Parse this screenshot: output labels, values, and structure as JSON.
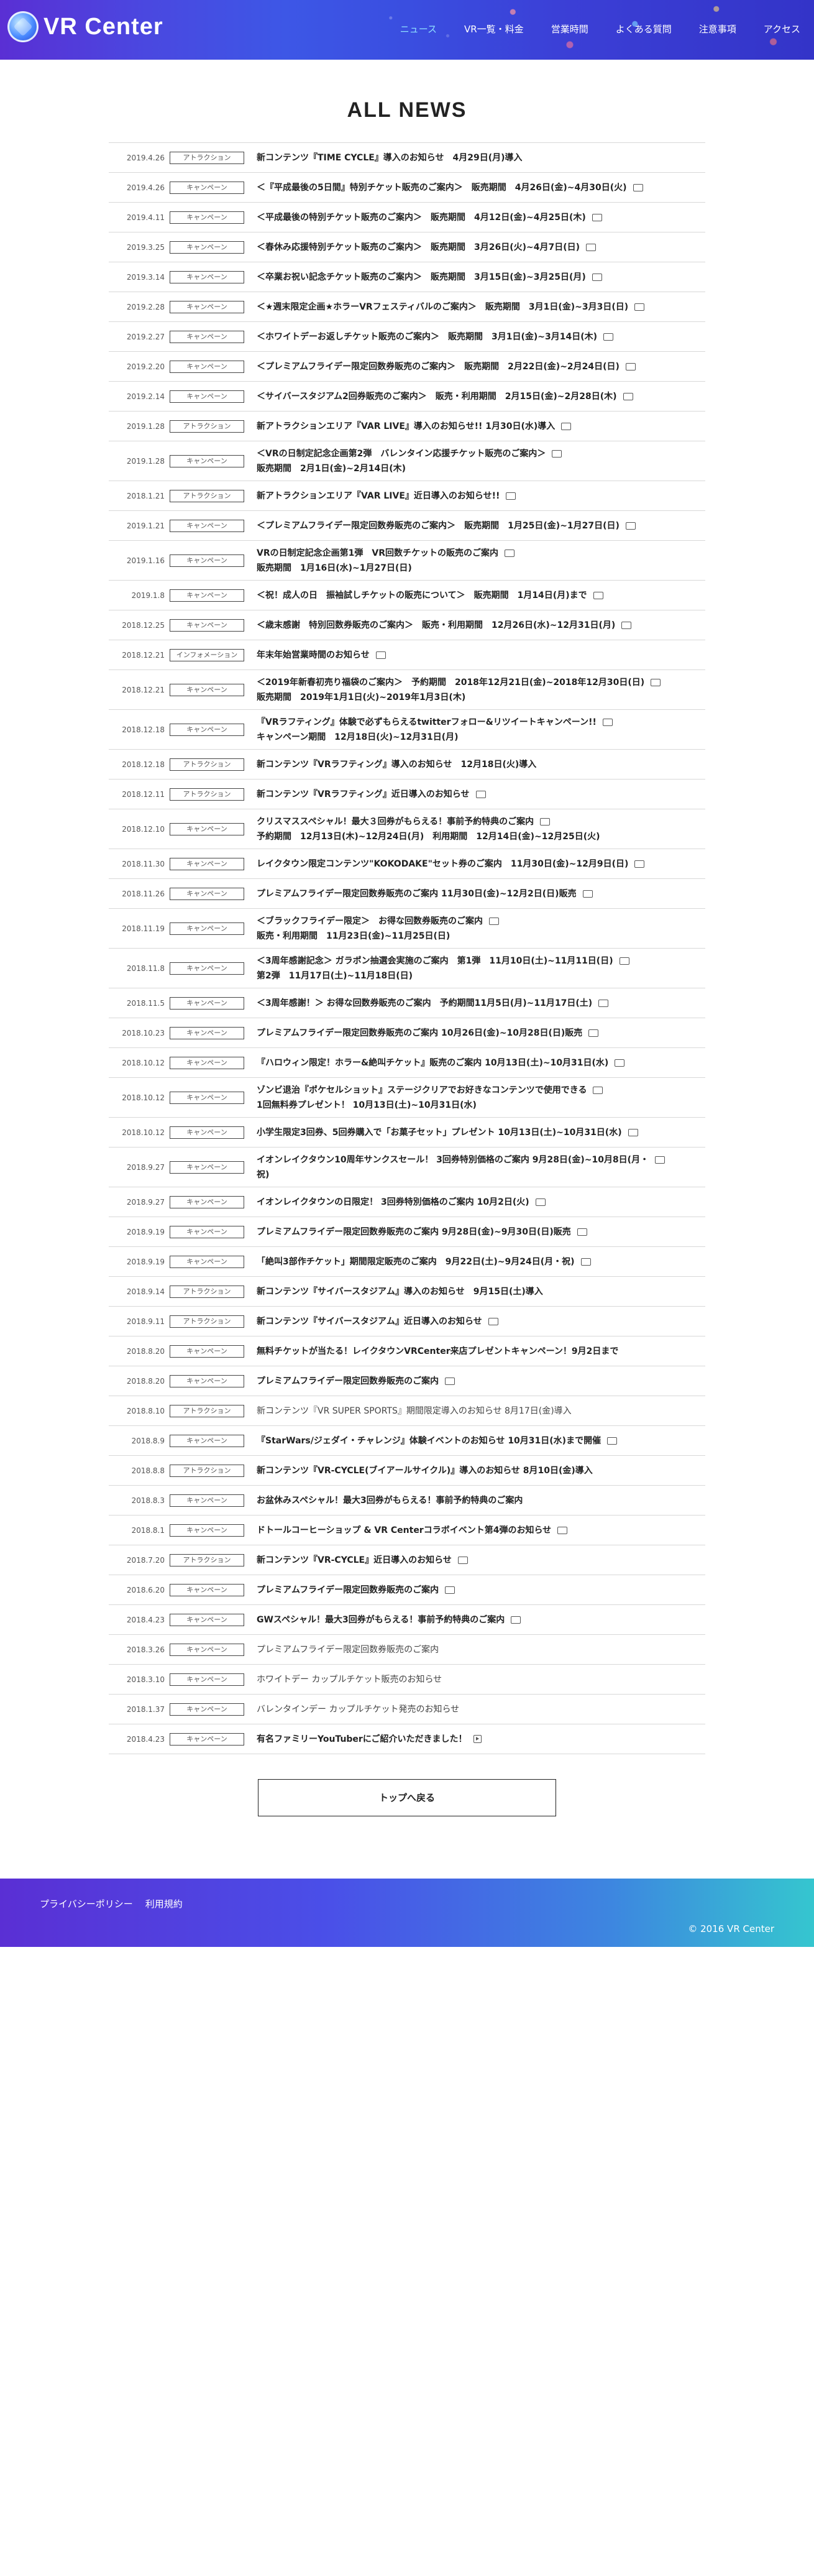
{
  "header": {
    "logo_text": "VR Center",
    "nav": [
      {
        "label": "ニュース",
        "active": true
      },
      {
        "label": "VR一覧・料金",
        "active": false
      },
      {
        "label": "営業時間",
        "active": false
      },
      {
        "label": "よくある質問",
        "active": false
      },
      {
        "label": "注意事項",
        "active": false
      },
      {
        "label": "アクセス",
        "active": false
      }
    ]
  },
  "page_title": "ALL NEWS",
  "news": [
    {
      "date": "2019.4.26",
      "category": "アトラクション",
      "lines": [
        "新コンテンツ『TIME CYCLE』導入のお知らせ　4月29日(月)導入"
      ],
      "icon": ""
    },
    {
      "date": "2019.4.26",
      "category": "キャンペーン",
      "lines": [
        "＜『平成最後の5日間』特別チケット販売のご案内＞　販売期間　4月26日(金)~4月30日(火)"
      ],
      "icon": "chat"
    },
    {
      "date": "2019.4.11",
      "category": "キャンペーン",
      "lines": [
        "＜平成最後の特別チケット販売のご案内＞　販売期間　4月12日(金)~4月25日(木)"
      ],
      "icon": "chat"
    },
    {
      "date": "2019.3.25",
      "category": "キャンペーン",
      "lines": [
        "＜春休み応援特別チケット販売のご案内＞　販売期間　3月26日(火)~4月7日(日)"
      ],
      "icon": "chat"
    },
    {
      "date": "2019.3.14",
      "category": "キャンペーン",
      "lines": [
        "＜卒業お祝い記念チケット販売のご案内＞　販売期間　3月15日(金)~3月25日(月)"
      ],
      "icon": "chat"
    },
    {
      "date": "2019.2.28",
      "category": "キャンペーン",
      "lines": [
        "＜★週末限定企画★ホラーVRフェスティバルのご案内＞　販売期間　3月1日(金)~3月3日(日)"
      ],
      "icon": "chat"
    },
    {
      "date": "2019.2.27",
      "category": "キャンペーン",
      "lines": [
        "＜ホワイトデーお返しチケット販売のご案内＞　販売期間　3月1日(金)~3月14日(木)"
      ],
      "icon": "chat"
    },
    {
      "date": "2019.2.20",
      "category": "キャンペーン",
      "lines": [
        "＜プレミアムフライデー限定回数券販売のご案内＞　販売期間　2月22日(金)~2月24日(日)"
      ],
      "icon": "chat"
    },
    {
      "date": "2019.2.14",
      "category": "キャンペーン",
      "lines": [
        "＜サイバースタジアム2回券販売のご案内＞　販売・利用期間　2月15日(金)~2月28日(木)"
      ],
      "icon": "chat"
    },
    {
      "date": "2019.1.28",
      "category": "アトラクション",
      "lines": [
        "新アトラクションエリア『VAR LIVE』導入のお知らせ!! 1月30日(水)導入"
      ],
      "icon": "chat"
    },
    {
      "date": "2019.1.28",
      "category": "キャンペーン",
      "lines": [
        "＜VRの日制定記念企画第2弾　バレンタイン応援チケット販売のご案内＞",
        "販売期間　2月1日(金)~2月14日(木)"
      ],
      "icon": "chat"
    },
    {
      "date": "2018.1.21",
      "category": "アトラクション",
      "lines": [
        "新アトラクションエリア『VAR LIVE』近日導入のお知らせ!!"
      ],
      "icon": "chat"
    },
    {
      "date": "2019.1.21",
      "category": "キャンペーン",
      "lines": [
        "＜プレミアムフライデー限定回数券販売のご案内＞　販売期間　1月25日(金)~1月27日(日)"
      ],
      "icon": "chat"
    },
    {
      "date": "2019.1.16",
      "category": "キャンペーン",
      "lines": [
        "VRの日制定記念企画第1弾　VR回数チケットの販売のご案内",
        "販売期間　1月16日(水)~1月27日(日)"
      ],
      "icon": "chat"
    },
    {
      "date": "2019.1.8",
      "category": "キャンペーン",
      "lines": [
        "＜祝！成人の日　振袖試しチケットの販売について＞　販売期間　1月14日(月)まで"
      ],
      "icon": "chat"
    },
    {
      "date": "2018.12.25",
      "category": "キャンペーン",
      "lines": [
        "＜歳末感謝　特別回数券販売のご案内＞　販売・利用期間　12月26日(水)~12月31日(月)"
      ],
      "icon": "chat"
    },
    {
      "date": "2018.12.21",
      "category": "インフォメーション",
      "lines": [
        "年末年始営業時間のお知らせ"
      ],
      "icon": "chat"
    },
    {
      "date": "2018.12.21",
      "category": "キャンペーン",
      "lines": [
        "＜2019年新春初売り福袋のご案内＞　予約期間　2018年12月21日(金)~2018年12月30日(日)",
        "販売期間　2019年1月1日(火)~2019年1月3日(木)"
      ],
      "icon": "chat"
    },
    {
      "date": "2018.12.18",
      "category": "キャンペーン",
      "lines": [
        "『VRラフティング』体験で必ずもらえるtwitterフォロー&リツイートキャンペーン!!",
        "キャンペーン期間　12月18日(火)~12月31日(月)"
      ],
      "icon": "chat"
    },
    {
      "date": "2018.12.18",
      "category": "アトラクション",
      "lines": [
        "新コンテンツ『VRラフティング』導入のお知らせ　12月18日(火)導入"
      ],
      "icon": ""
    },
    {
      "date": "2018.12.11",
      "category": "アトラクション",
      "lines": [
        "新コンテンツ『VRラフティング』近日導入のお知らせ"
      ],
      "icon": "chat"
    },
    {
      "date": "2018.12.10",
      "category": "キャンペーン",
      "lines": [
        "クリスマススペシャル！最大３回券がもらえる！事前予約特典のご案内",
        "予約期間　12月13日(木)~12月24日(月)　利用期間　12月14日(金)~12月25日(火)"
      ],
      "icon": "chat"
    },
    {
      "date": "2018.11.30",
      "category": "キャンペーン",
      "lines": [
        "レイクタウン限定コンテンツ\"KOKODAKE\"セット券のご案内　11月30日(金)~12月9日(日)"
      ],
      "icon": "chat"
    },
    {
      "date": "2018.11.26",
      "category": "キャンペーン",
      "lines": [
        "プレミアムフライデー限定回数券販売のご案内 11月30日(金)~12月2日(日)販売"
      ],
      "icon": "chat"
    },
    {
      "date": "2018.11.19",
      "category": "キャンペーン",
      "lines": [
        "＜ブラックフライデー限定＞　お得な回数券販売のご案内",
        "販売・利用期間　11月23日(金)~11月25日(日)"
      ],
      "icon": "chat"
    },
    {
      "date": "2018.11.8",
      "category": "キャンペーン",
      "lines": [
        "＜3周年感謝記念＞ ガラポン抽選会実施のご案内　第1弾　11月10日(土)~11月11日(日)",
        "第2弾　11月17日(土)~11月18日(日)"
      ],
      "icon": "chat"
    },
    {
      "date": "2018.11.5",
      "category": "キャンペーン",
      "lines": [
        "＜3周年感謝！＞ お得な回数券販売のご案内　予約期間11月5日(月)~11月17日(土)"
      ],
      "icon": "chat"
    },
    {
      "date": "2018.10.23",
      "category": "キャンペーン",
      "lines": [
        "プレミアムフライデー限定回数券販売のご案内 10月26日(金)~10月28日(日)販売"
      ],
      "icon": "chat"
    },
    {
      "date": "2018.10.12",
      "category": "キャンペーン",
      "lines": [
        "『ハロウィン限定！ホラー&絶叫チケット』販売のご案内 10月13日(土)~10月31日(水)"
      ],
      "icon": "chat"
    },
    {
      "date": "2018.10.12",
      "category": "キャンペーン",
      "lines": [
        "ゾンビ退治『ポケセルショット』ステージクリアでお好きなコンテンツで使用できる",
        "1回無料券プレゼント！ 10月13日(土)~10月31日(水)"
      ],
      "icon": "chat"
    },
    {
      "date": "2018.10.12",
      "category": "キャンペーン",
      "lines": [
        "小学生限定3回券、5回券購入で「お菓子セット」プレゼント 10月13日(土)~10月31日(水)"
      ],
      "icon": "chat"
    },
    {
      "date": "2018.9.27",
      "category": "キャンペーン",
      "lines": [
        "イオンレイクタウン10周年サンクスセール！ 3回券特別価格のご案内 9月28日(金)~10月8日(月・",
        "祝)"
      ],
      "icon": "chat"
    },
    {
      "date": "2018.9.27",
      "category": "キャンペーン",
      "lines": [
        "イオンレイクタウンの日限定！ 3回券特別価格のご案内 10月2日(火)"
      ],
      "icon": "chat"
    },
    {
      "date": "2018.9.19",
      "category": "キャンペーン",
      "lines": [
        "プレミアムフライデー限定回数券販売のご案内 9月28日(金)~9月30日(日)販売"
      ],
      "icon": "chat"
    },
    {
      "date": "2018.9.19",
      "category": "キャンペーン",
      "lines": [
        "「絶叫3部作チケット」期間限定販売のご案内　9月22日(土)~9月24日(月・祝)"
      ],
      "icon": "chat"
    },
    {
      "date": "2018.9.14",
      "category": "アトラクション",
      "lines": [
        "新コンテンツ『サイバースタジアム』導入のお知らせ　9月15日(土)導入"
      ],
      "icon": ""
    },
    {
      "date": "2018.9.11",
      "category": "アトラクション",
      "lines": [
        "新コンテンツ『サイバースタジアム』近日導入のお知らせ"
      ],
      "icon": "chat"
    },
    {
      "date": "2018.8.20",
      "category": "キャンペーン",
      "lines": [
        "無料チケットが当たる！レイクタウンVRCenter来店プレゼントキャンペーン！9月2日まで"
      ],
      "icon": ""
    },
    {
      "date": "2018.8.20",
      "category": "キャンペーン",
      "lines": [
        "プレミアムフライデー限定回数券販売のご案内"
      ],
      "icon": "chat"
    },
    {
      "date": "2018.8.10",
      "category": "アトラクション",
      "lines": [
        "新コンテンツ『VR SUPER SPORTS』期間限定導入のお知らせ 8月17日(金)導入"
      ],
      "icon": "",
      "light": true
    },
    {
      "date": "2018.8.9",
      "category": "キャンペーン",
      "lines": [
        "『StarWars/ジェダイ・チャレンジ』体験イベントのお知らせ 10月31日(水)まで開催"
      ],
      "icon": "chat"
    },
    {
      "date": "2018.8.8",
      "category": "アトラクション",
      "lines": [
        "新コンテンツ『VR-CYCLE(ブイアールサイクル)』導入のお知らせ 8月10日(金)導入"
      ],
      "icon": ""
    },
    {
      "date": "2018.8.3",
      "category": "キャンペーン",
      "lines": [
        "お盆休みスペシャル！最大3回券がもらえる！事前予約特典のご案内"
      ],
      "icon": ""
    },
    {
      "date": "2018.8.1",
      "category": "キャンペーン",
      "lines": [
        "ドトールコーヒーショップ & VR Centerコラボイベント第4弾のお知らせ"
      ],
      "icon": "chat"
    },
    {
      "date": "2018.7.20",
      "category": "アトラクション",
      "lines": [
        "新コンテンツ『VR-CYCLE』近日導入のお知らせ"
      ],
      "icon": "chat"
    },
    {
      "date": "2018.6.20",
      "category": "キャンペーン",
      "lines": [
        "プレミアムフライデー限定回数券販売のご案内"
      ],
      "icon": "chat"
    },
    {
      "date": "2018.4.23",
      "category": "キャンペーン",
      "lines": [
        "GWスペシャル！最大3回券がもらえる！事前予約特典のご案内"
      ],
      "icon": "chat"
    },
    {
      "date": "2018.3.26",
      "category": "キャンペーン",
      "lines": [
        "プレミアムフライデー限定回数券販売のご案内"
      ],
      "icon": "",
      "light": true
    },
    {
      "date": "2018.3.10",
      "category": "キャンペーン",
      "lines": [
        "ホワイトデー カップルチケット販売のお知らせ"
      ],
      "icon": "",
      "light": true
    },
    {
      "date": "2018.1.37",
      "category": "キャンペーン",
      "lines": [
        "バレンタインデー カップルチケット発売のお知らせ"
      ],
      "icon": "",
      "light": true
    },
    {
      "date": "2018.4.23",
      "category": "キャンペーン",
      "lines": [
        "有名ファミリーYouTuberにご紹介いただきました！"
      ],
      "icon": "play"
    }
  ],
  "back_button": "トップへ戻る",
  "footer": {
    "links": [
      "プライバシーポリシー",
      "利用規約"
    ],
    "copyright": "© 2016 VR Center"
  }
}
